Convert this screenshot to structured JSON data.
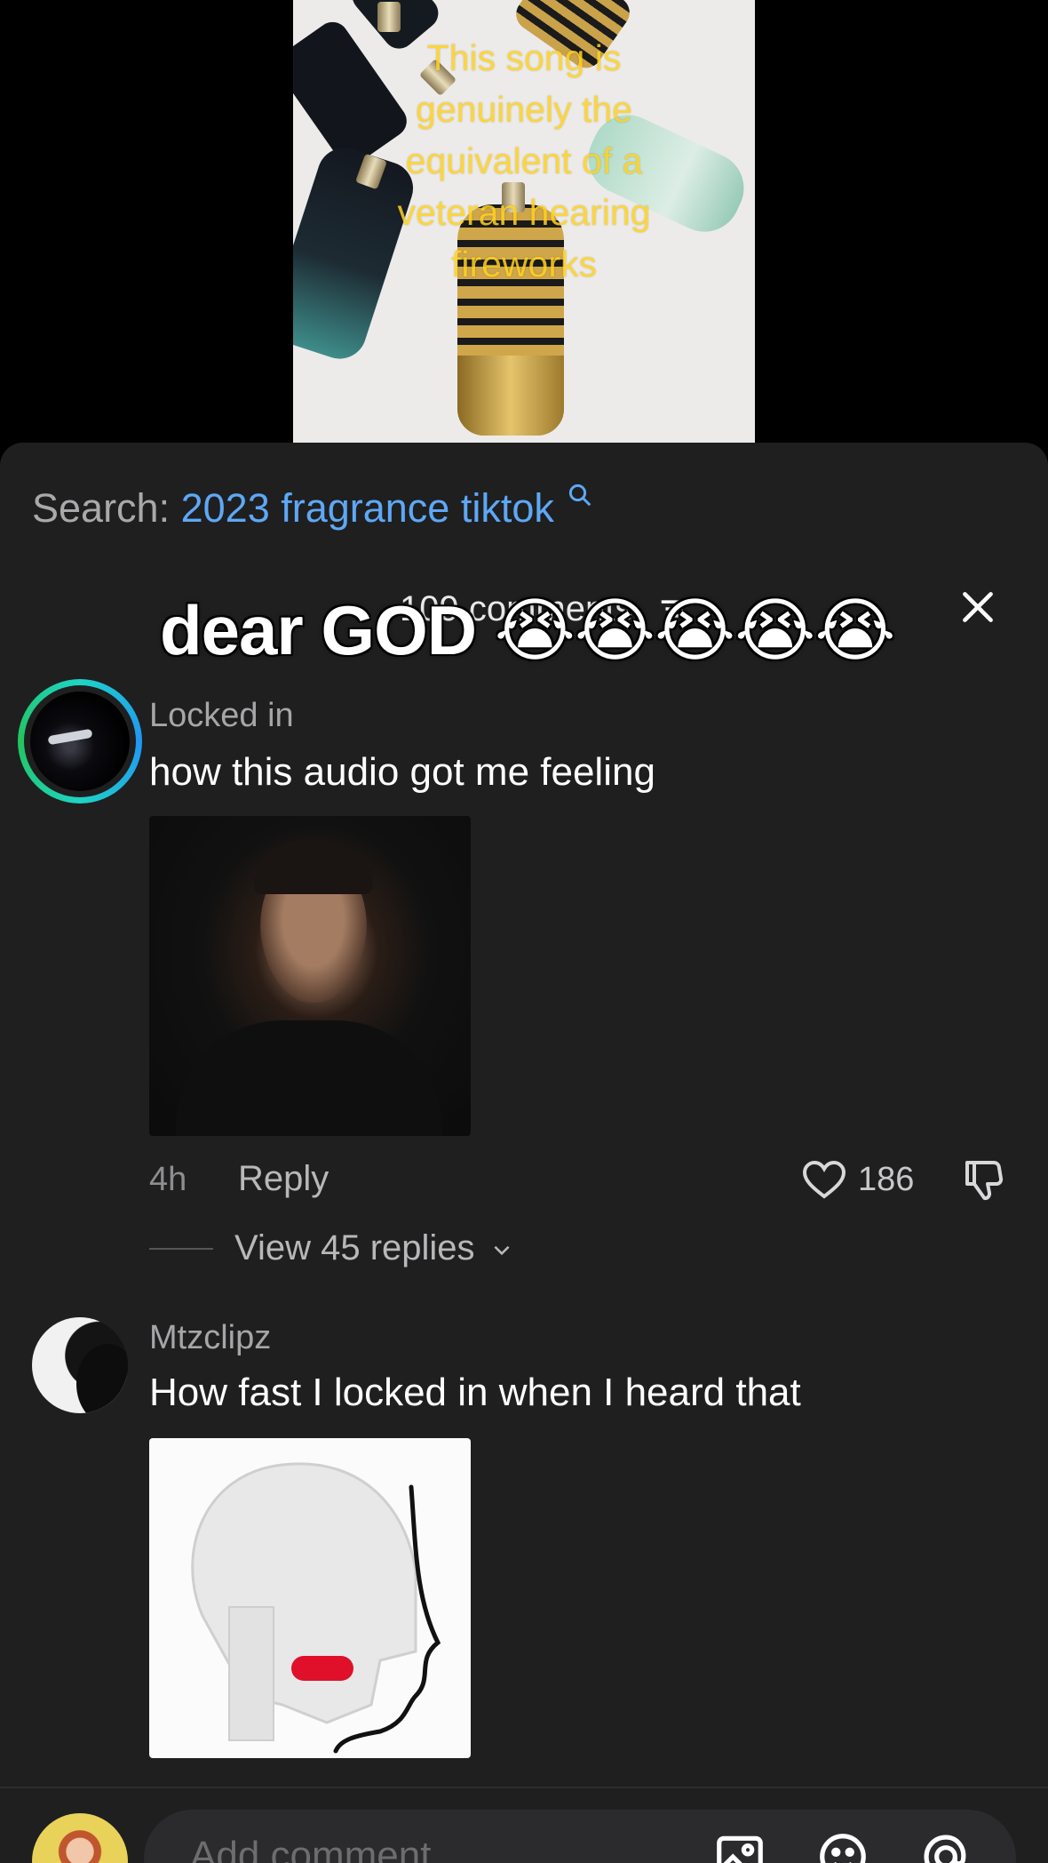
{
  "video": {
    "caption": "This song is\ngenuinely the\nequivalent of a\nveteran hearing\nfireworks"
  },
  "search": {
    "prefix": "Search:",
    "term": "2023 fragrance tiktok"
  },
  "header": {
    "comments_count": "109 comments",
    "overlay_caption": "dear GOD 😭😭😭😭😭"
  },
  "comments": [
    {
      "username": "Locked in",
      "text": "how this audio got me feeling",
      "time": "4h",
      "reply_label": "Reply",
      "likes": "186",
      "view_replies": "View 45 replies"
    },
    {
      "username": "Mtzclipz",
      "text": "How fast I locked in when I heard that"
    }
  ],
  "composer": {
    "placeholder": "Add comment..."
  },
  "icons": [
    "search-icon",
    "filter-icon",
    "close-icon",
    "heart-icon",
    "dislike-icon",
    "chevron-down-icon",
    "image-icon",
    "emoji-icon",
    "mention-icon"
  ],
  "colors": {
    "sheet_bg": "#1f1f20",
    "link_blue": "#5ea8f5",
    "caption_yellow": "#ffd21f"
  }
}
